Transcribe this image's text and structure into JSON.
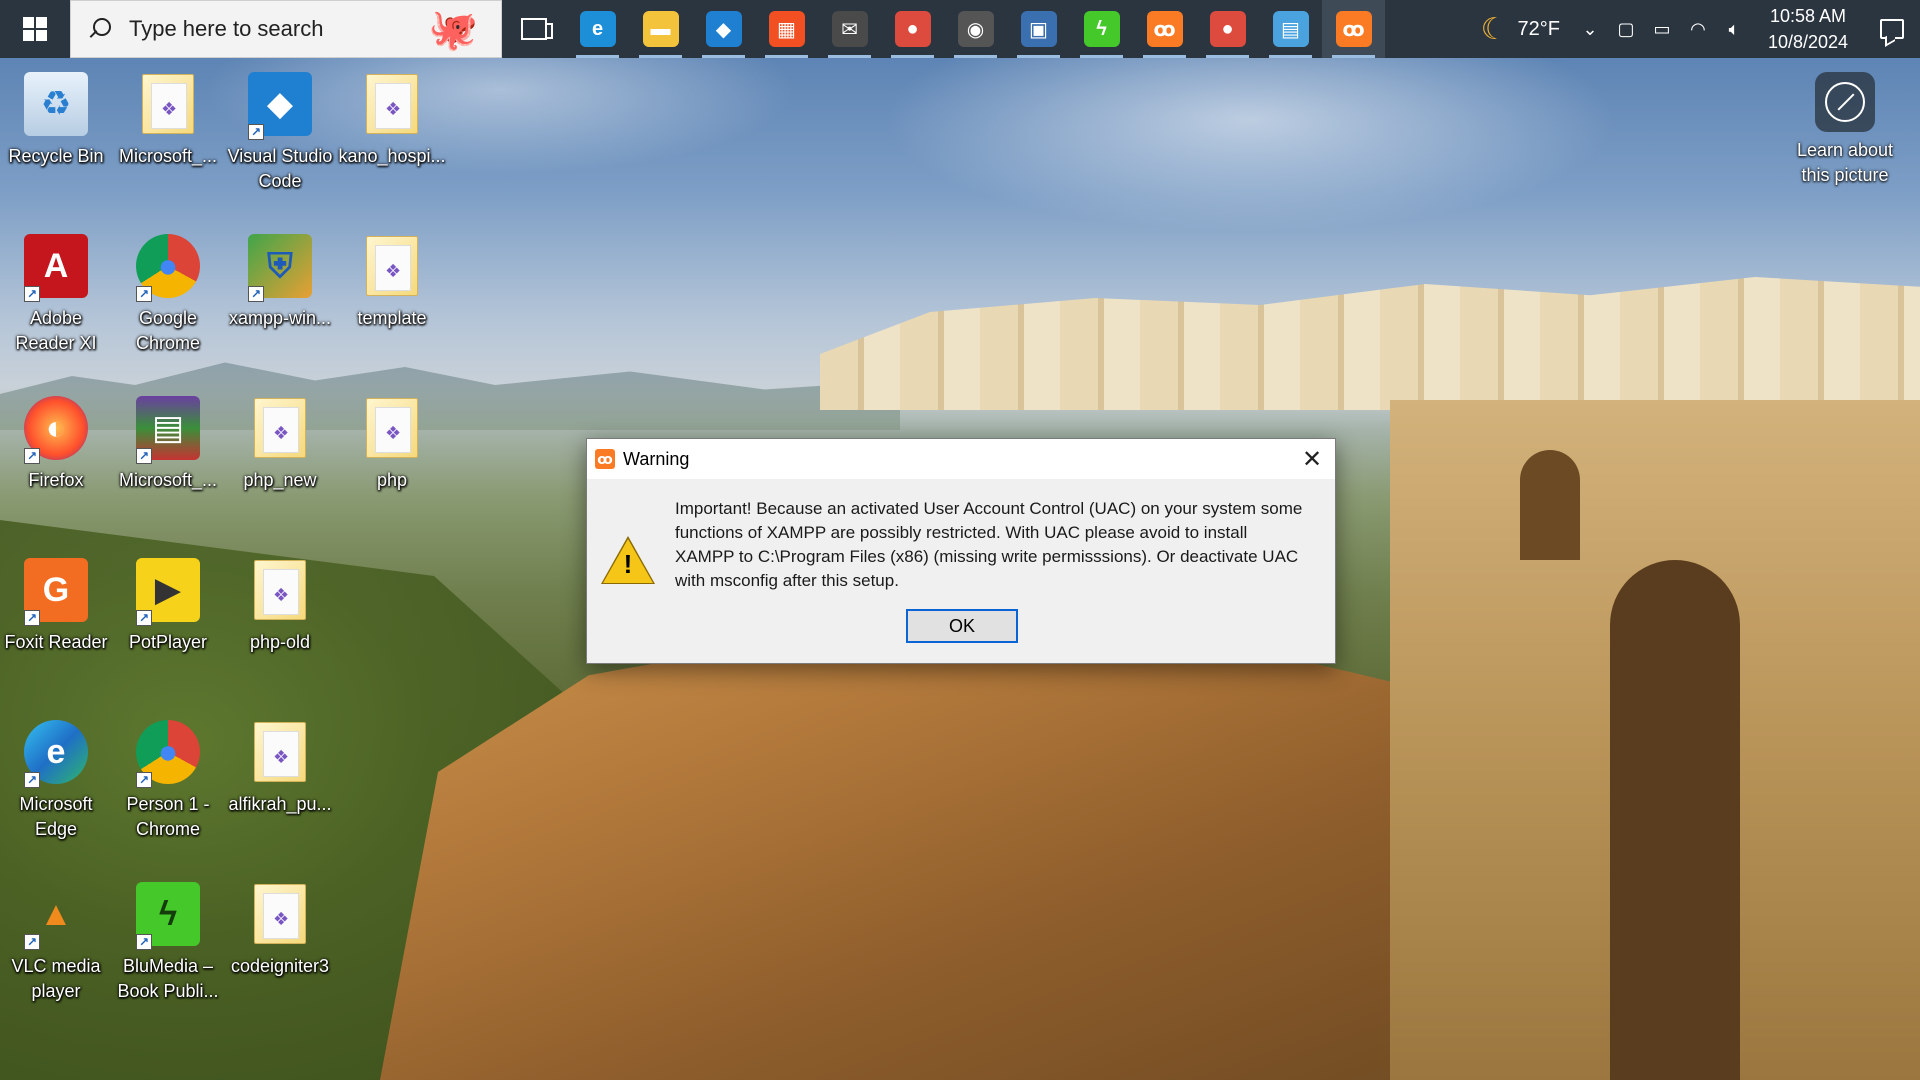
{
  "taskbar": {
    "search_placeholder": "Type here to search",
    "pinned_apps": [
      {
        "name": "edge",
        "glyph": "e",
        "color": "#1d8fd8"
      },
      {
        "name": "file-explorer",
        "glyph": "▬",
        "color": "#f3c43b"
      },
      {
        "name": "vscode",
        "glyph": "◆",
        "color": "#1f7fd1"
      },
      {
        "name": "microsoft-store",
        "glyph": "▦",
        "color": "#f25022"
      },
      {
        "name": "mail",
        "glyph": "✉",
        "color": "#4a4a4a"
      },
      {
        "name": "chrome",
        "glyph": "●",
        "color": "#dd4b3e"
      },
      {
        "name": "webcam-app",
        "glyph": "◉",
        "color": "#555555"
      },
      {
        "name": "remote-desktop",
        "glyph": "▣",
        "color": "#3a6fb0"
      },
      {
        "name": "blumedia",
        "glyph": "ϟ",
        "color": "#45c82a"
      },
      {
        "name": "xampp-control",
        "glyph": "ꝏ",
        "color": "#fb7a24"
      },
      {
        "name": "chrome-profile",
        "glyph": "●",
        "color": "#dd4b3e"
      },
      {
        "name": "control-panel",
        "glyph": "▤",
        "color": "#4aa3df"
      },
      {
        "name": "xampp-setup",
        "glyph": "ꝏ",
        "color": "#fb7a24"
      }
    ],
    "weather_temp": "72°F",
    "clock_time": "10:58 AM",
    "clock_date": "10/8/2024"
  },
  "desktop": {
    "icons": [
      {
        "label": "Recycle Bin",
        "type": "recycle"
      },
      {
        "label": "Microsoft_...",
        "type": "folder"
      },
      {
        "label": "Visual Studio Code",
        "type": "vscode"
      },
      {
        "label": "kano_hospi...",
        "type": "folder"
      },
      {
        "label": "Adobe Reader XI",
        "type": "adobe"
      },
      {
        "label": "Google Chrome",
        "type": "chrome"
      },
      {
        "label": "xampp-win...",
        "type": "xampp-installer"
      },
      {
        "label": "template",
        "type": "folder"
      },
      {
        "label": "Firefox",
        "type": "firefox"
      },
      {
        "label": "Microsoft_...",
        "type": "winrar"
      },
      {
        "label": "php_new",
        "type": "folder"
      },
      {
        "label": "php",
        "type": "folder"
      },
      {
        "label": "Foxit Reader",
        "type": "foxit"
      },
      {
        "label": "PotPlayer",
        "type": "potplayer"
      },
      {
        "label": "php-old",
        "type": "folder"
      },
      {
        "label": "Microsoft Edge",
        "type": "edge"
      },
      {
        "label": "Person 1 - Chrome",
        "type": "chrome"
      },
      {
        "label": "alfikrah_pu...",
        "type": "folder"
      },
      {
        "label": "VLC media player",
        "type": "vlc"
      },
      {
        "label": "BluMedia – Book Publi...",
        "type": "blumedia"
      },
      {
        "label": "codeigniter3",
        "type": "folder"
      }
    ],
    "learn_label": "Learn about this picture"
  },
  "dialog": {
    "title": "Warning",
    "message": "Important! Because an activated User Account Control (UAC) on your system some functions of XAMPP are possibly restricted. With UAC please avoid to install XAMPP to C:\\Program Files (x86) (missing write permisssions). Or deactivate UAC with msconfig after this setup.",
    "ok_label": "OK",
    "close_glyph": "✕"
  }
}
